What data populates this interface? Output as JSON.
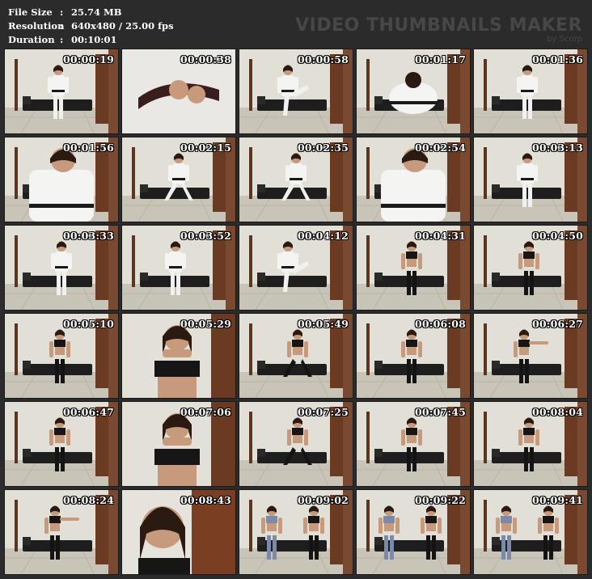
{
  "info": {
    "file_size_label": "File Size",
    "file_size": "25.74 MB",
    "resolution_label": "Resolution",
    "resolution": "640x480 / 25.00 fps",
    "duration_label": "Duration",
    "duration": "00:10:01"
  },
  "brand": {
    "title": "VIDEO THUMBNAILS MAKER",
    "sub": "by Scorp"
  },
  "thumbnails": [
    {
      "time": "00:00:19",
      "scene": "gi-full"
    },
    {
      "time": "00:00:38",
      "scene": "belt-close"
    },
    {
      "time": "00:00:58",
      "scene": "gi-kick"
    },
    {
      "time": "00:01:17",
      "scene": "gi-crouch"
    },
    {
      "time": "00:01:36",
      "scene": "gi-full"
    },
    {
      "time": "00:01:56",
      "scene": "gi-close"
    },
    {
      "time": "00:02:15",
      "scene": "gi-stance"
    },
    {
      "time": "00:02:35",
      "scene": "gi-stance"
    },
    {
      "time": "00:02:54",
      "scene": "gi-close"
    },
    {
      "time": "00:03:13",
      "scene": "gi-full"
    },
    {
      "time": "00:03:33",
      "scene": "gi-front"
    },
    {
      "time": "00:03:52",
      "scene": "gi-full"
    },
    {
      "time": "00:04:12",
      "scene": "gi-kick"
    },
    {
      "time": "00:04:31",
      "scene": "black-stand"
    },
    {
      "time": "00:04:50",
      "scene": "black-stand"
    },
    {
      "time": "00:05:10",
      "scene": "black-stand"
    },
    {
      "time": "00:05:29",
      "scene": "black-close"
    },
    {
      "time": "00:05:49",
      "scene": "black-walk"
    },
    {
      "time": "00:06:08",
      "scene": "black-stand"
    },
    {
      "time": "00:06:27",
      "scene": "black-point"
    },
    {
      "time": "00:06:47",
      "scene": "black-stand"
    },
    {
      "time": "00:07:06",
      "scene": "black-close"
    },
    {
      "time": "00:07:25",
      "scene": "black-walk"
    },
    {
      "time": "00:07:45",
      "scene": "black-stand"
    },
    {
      "time": "00:08:04",
      "scene": "black-stand"
    },
    {
      "time": "00:08:24",
      "scene": "black-point"
    },
    {
      "time": "00:08:43",
      "scene": "face-close"
    },
    {
      "time": "00:09:02",
      "scene": "two-people"
    },
    {
      "time": "00:09:22",
      "scene": "two-people"
    },
    {
      "time": "00:09:41",
      "scene": "two-people"
    }
  ]
}
